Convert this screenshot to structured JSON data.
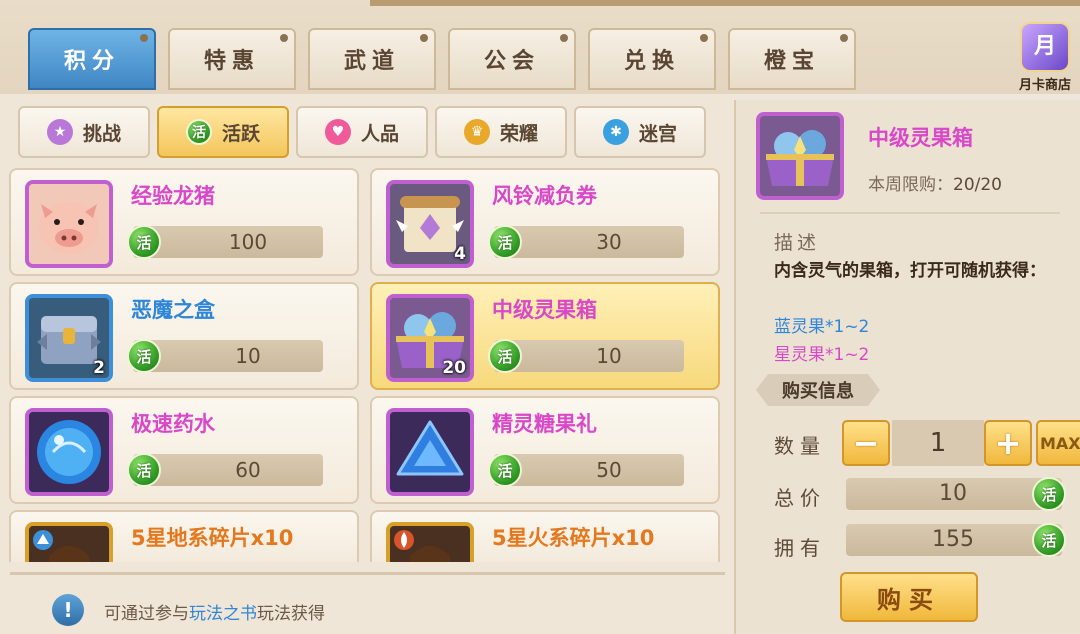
{
  "top_tabs": [
    "积分",
    "特惠",
    "武道",
    "公会",
    "兑换",
    "橙宝"
  ],
  "month_card": {
    "icon": "月",
    "label": "月卡商店"
  },
  "sub_tabs": [
    "挑战",
    "活跃",
    "人品",
    "荣耀",
    "迷宫"
  ],
  "currency_icon": "活",
  "items": [
    {
      "name": "经验龙猪",
      "price": "100",
      "count": ""
    },
    {
      "name": "风铃减负券",
      "price": "30",
      "count": "4"
    },
    {
      "name": "恶魔之盒",
      "price": "10",
      "count": "2"
    },
    {
      "name": "中级灵果箱",
      "price": "10",
      "count": "20"
    },
    {
      "name": "极速药水",
      "price": "60",
      "count": ""
    },
    {
      "name": "精灵糖果礼",
      "price": "50",
      "count": ""
    },
    {
      "name": "5星地系碎片x10",
      "price": "",
      "count": ""
    },
    {
      "name": "5星火系碎片x10",
      "price": "",
      "count": ""
    }
  ],
  "tip": {
    "prefix": "可通过参与",
    "link": "玩法之书",
    "suffix": "玩法获得"
  },
  "detail": {
    "name": "中级灵果箱",
    "limit_label": "本周限购：",
    "limit_value": "20/20",
    "desc_label": "描述",
    "desc": "内含灵气的果箱，打开可随机获得：",
    "drop1": "蓝灵果*1~2",
    "drop2": "星灵果*1~2",
    "buy_info": "购买信息",
    "qty_label": "数量",
    "qty": "1",
    "minus": "−",
    "plus": "+",
    "max": "MAX",
    "total_label": "总价",
    "total": "10",
    "own_label": "拥有",
    "own": "155",
    "buy": "购买"
  }
}
